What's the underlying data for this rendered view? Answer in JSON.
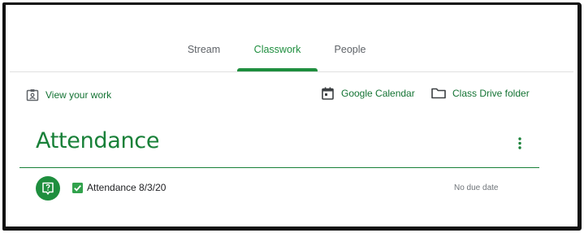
{
  "tabs": [
    {
      "label": "Stream"
    },
    {
      "label": "Classwork",
      "active": true
    },
    {
      "label": "People"
    }
  ],
  "actions": {
    "view_work": "View your work",
    "calendar": "Google Calendar",
    "drive": "Class Drive folder"
  },
  "section": {
    "title": "Attendance",
    "items": [
      {
        "title": "Attendance 8/3/20",
        "due": "No due date"
      }
    ]
  },
  "colors": {
    "accent": "#1e8e3e",
    "text_secondary": "#5f6368"
  }
}
